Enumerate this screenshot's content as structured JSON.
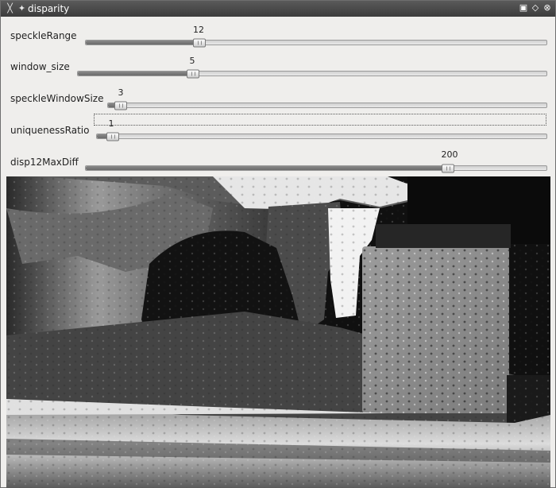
{
  "window": {
    "title": "disparity",
    "app_icon": "window-menu-icon",
    "pin_icon": "pin-icon",
    "buttons": [
      "minimize-icon",
      "maximize-icon",
      "close-icon"
    ]
  },
  "trackbars": [
    {
      "label": "speckleRange",
      "value": "12",
      "fraction": 0.247
    },
    {
      "label": "window_size",
      "value": "5",
      "fraction": 0.246
    },
    {
      "label": "speckleWindowSize",
      "value": "3",
      "fraction": 0.029
    },
    {
      "label": "uniquenessRatio",
      "value": "1",
      "fraction": 0.035
    },
    {
      "label": "disp12MaxDiff",
      "value": "200",
      "fraction": 0.786
    }
  ],
  "image": {
    "description_icon": "disparity-map-image"
  }
}
